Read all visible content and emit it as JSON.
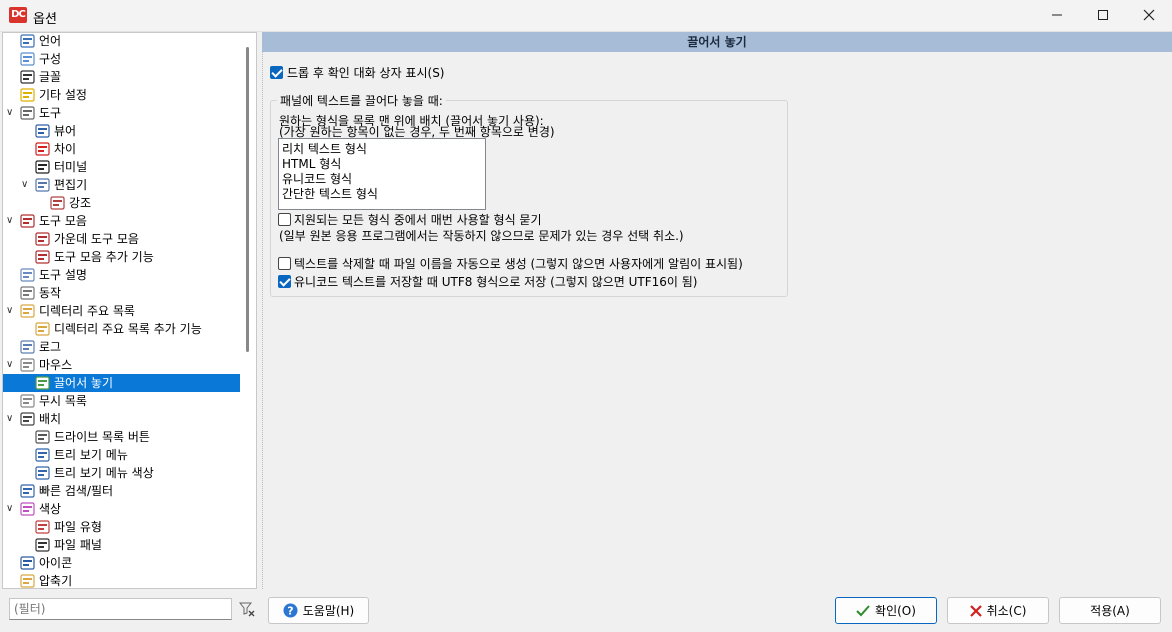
{
  "window": {
    "title": "옵션",
    "app_icon_text": "DC",
    "controls": {
      "minimize": "minimize-icon",
      "maximize": "maximize-icon",
      "close": "close-icon"
    }
  },
  "tree": {
    "items": [
      {
        "label": "언어",
        "icon": "language-icon"
      },
      {
        "label": "구성",
        "icon": "config-icon"
      },
      {
        "label": "글꼴",
        "icon": "font-icon"
      },
      {
        "label": "기타 설정",
        "icon": "misc-icon"
      },
      {
        "label": "도구",
        "icon": "tools-icon"
      },
      {
        "label": "뷰어",
        "icon": "viewer-icon"
      },
      {
        "label": "차이",
        "icon": "diff-icon"
      },
      {
        "label": "터미널",
        "icon": "terminal-icon"
      },
      {
        "label": "편집기",
        "icon": "editor-icon"
      },
      {
        "label": "강조",
        "icon": "highlight-icon"
      },
      {
        "label": "도구 모음",
        "icon": "toolbar-icon"
      },
      {
        "label": "가운데 도구 모음",
        "icon": "middle-toolbar-icon"
      },
      {
        "label": "도구 모음 추가 기능",
        "icon": "toolbar-extra-icon"
      },
      {
        "label": "도구 설명",
        "icon": "tooltip-icon"
      },
      {
        "label": "동작",
        "icon": "behavior-icon"
      },
      {
        "label": "디렉터리 주요 목록",
        "icon": "folder-hotlist-icon"
      },
      {
        "label": "디렉터리 주요 목록 추가 기능",
        "icon": "folder-hotlist-extra-icon"
      },
      {
        "label": "로그",
        "icon": "log-icon"
      },
      {
        "label": "마우스",
        "icon": "mouse-icon"
      },
      {
        "label": "끌어서 놓기",
        "icon": "drag-drop-icon"
      },
      {
        "label": "무시 목록",
        "icon": "ignore-list-icon"
      },
      {
        "label": "배치",
        "icon": "layout-icon"
      },
      {
        "label": "드라이브 목록 버튼",
        "icon": "drive-list-icon"
      },
      {
        "label": "트리 보기 메뉴",
        "icon": "tree-menu-icon"
      },
      {
        "label": "트리 보기 메뉴 색상",
        "icon": "tree-menu-color-icon"
      },
      {
        "label": "빠른 검색/필터",
        "icon": "quick-search-icon"
      },
      {
        "label": "색상",
        "icon": "colors-icon"
      },
      {
        "label": "파일 유형",
        "icon": "file-types-icon"
      },
      {
        "label": "파일 패널",
        "icon": "file-panels-icon"
      },
      {
        "label": "아이콘",
        "icon": "icons-icon"
      },
      {
        "label": "압축기",
        "icon": "archiver-icon"
      }
    ],
    "selected_label": "끌어서 놓기"
  },
  "filter": {
    "placeholder": "(필터)"
  },
  "page": {
    "header": "끌어서 놓기",
    "show_confirm": {
      "label": "드롭 후 확인 대화 상자 표시(S)",
      "checked": true
    },
    "group": {
      "title": "패널에 텍스트를 끌어다 놓을 때:",
      "desc_line1": "원하는 형식을 목록 맨 위에 배치 (끌어서 놓기 사용):",
      "desc_line2": "(가장 원하는 항목이 없는 경우, 두 번째 항목으로 변경)",
      "formats": [
        "리치 텍스트 형식",
        "HTML 형식",
        "유니코드 형식",
        "간단한 텍스트 형식"
      ],
      "ask_format": {
        "label": "지원되는 모든 형식 중에서 매번 사용할 형식 묻기",
        "checked": false
      },
      "ask_note": "(일부 원본 응용 프로그램에서는 작동하지 않으므로 문제가 있는 경우 선택 취소.)",
      "auto_filename": {
        "label": "텍스트를 삭제할 때 파일 이름을 자동으로 생성 (그렇지 않으면 사용자에게 알림이 표시됨)",
        "checked": false
      },
      "utf8": {
        "label": "유니코드 텍스트를 저장할 때 UTF8 형식으로 저장 (그렇지 않으면 UTF16이 됨)",
        "checked": true
      }
    }
  },
  "buttons": {
    "help": "도움말(H)",
    "ok": "확인(O)",
    "cancel": "취소(C)",
    "apply": "적용(A)"
  },
  "colors": {
    "selection": "#0a78d7",
    "header_bg": "#a7bcd7",
    "checkbox": "#0a67c0",
    "ok_icon": "#2e8b2e",
    "cancel_icon": "#d21f1f"
  }
}
